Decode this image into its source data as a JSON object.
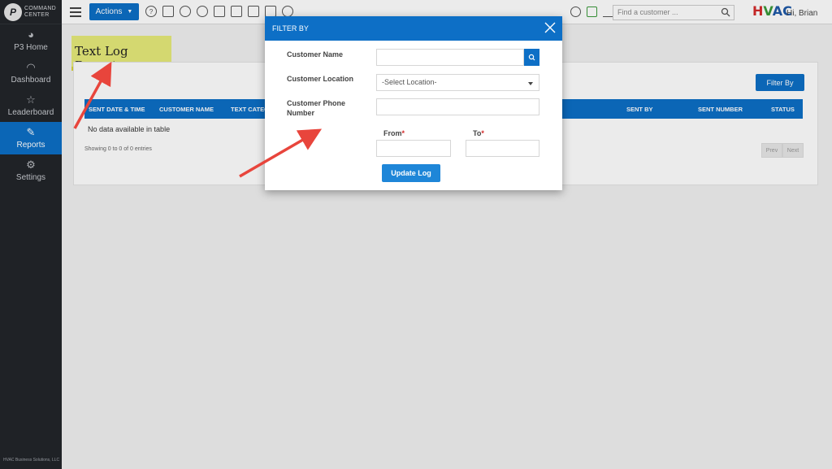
{
  "brand": {
    "name_line1": "COMMAND",
    "name_line2": "CENTER",
    "logo_glyph": "P"
  },
  "sidebar": {
    "items": [
      {
        "label": "P3 Home",
        "icon": "P3-home-icon"
      },
      {
        "label": "Dashboard",
        "icon": "gauge-icon"
      },
      {
        "label": "Leaderboard",
        "icon": "trophy-icon"
      },
      {
        "label": "Reports",
        "icon": "report-icon",
        "active": true
      },
      {
        "label": "Settings",
        "icon": "gear-icon"
      }
    ],
    "footer": "HVAC Business Solutions, LLC"
  },
  "topbar": {
    "actions_label": "Actions",
    "search_placeholder": "Find a customer ...",
    "greeting": "Hi, Brian",
    "logo": {
      "h": "H",
      "v": "V",
      "ac": "AC"
    }
  },
  "page": {
    "title": "Text Log Report"
  },
  "card": {
    "filter_button": "Filter By",
    "columns": [
      "SENT DATE & TIME",
      "CUSTOMER NAME",
      "TEXT CATEG",
      "SENT BY",
      "SENT NUMBER",
      "STATUS"
    ],
    "empty_message": "No data available in table",
    "showing": "Showing 0 to 0 of 0 entries",
    "pager": {
      "prev": "Prev",
      "next": "Next"
    }
  },
  "modal": {
    "title": "FILTER BY",
    "customer_name_label": "Customer Name",
    "customer_name_value": "",
    "customer_location_label": "Customer Location",
    "customer_location_value": "-Select Location-",
    "customer_phone_label_line1": "Customer Phone",
    "customer_phone_label_line2": "Number",
    "customer_phone_value": "",
    "from_label": "From",
    "to_label": "To",
    "required_mark": "*",
    "from_value": "",
    "to_value": "",
    "update_button": "Update Log"
  },
  "colors": {
    "primary": "#0d6fc6",
    "sidebar": "#22252a",
    "highlight": "#e7eb7a",
    "arrow": "#e8453c"
  }
}
